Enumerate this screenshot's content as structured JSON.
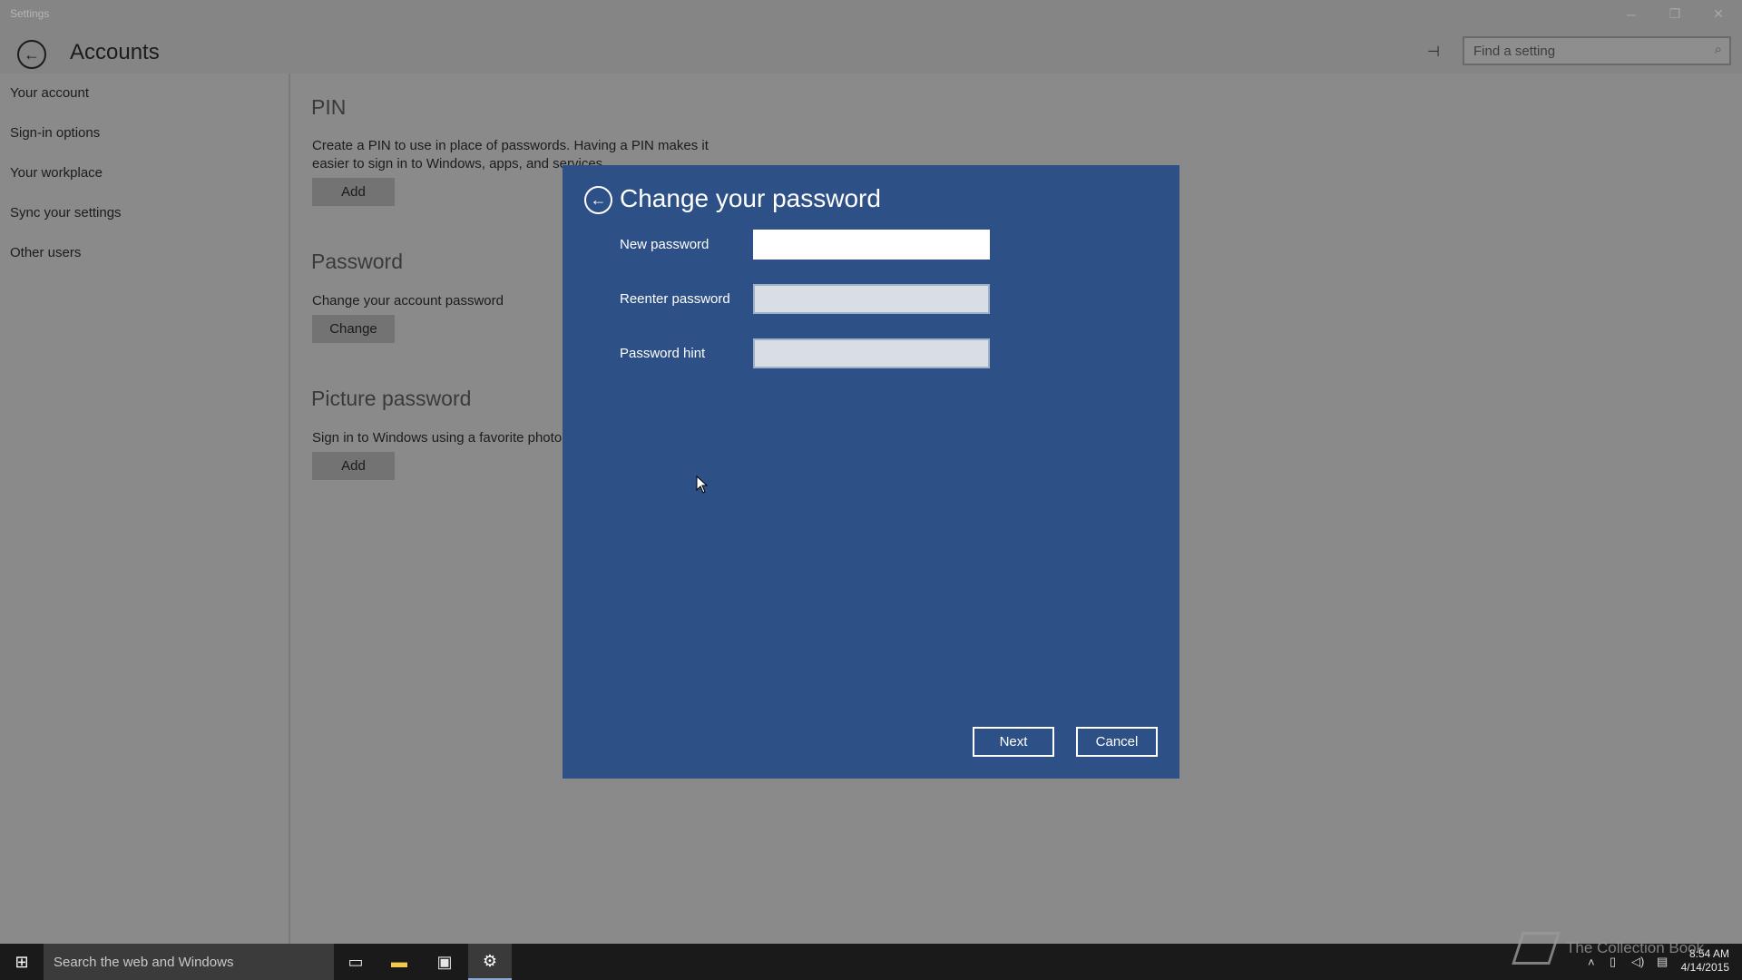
{
  "window": {
    "title": "Settings",
    "minimize": "─",
    "restore": "❐",
    "close": "✕"
  },
  "header": {
    "title": "Accounts",
    "back": "←",
    "pin": "⊣",
    "search_placeholder": "Find a setting",
    "search_icon": "⌕"
  },
  "sidebar": {
    "items": [
      {
        "label": "Your account"
      },
      {
        "label": "Sign-in options"
      },
      {
        "label": "Your workplace"
      },
      {
        "label": "Sync your settings"
      },
      {
        "label": "Other users"
      }
    ]
  },
  "main": {
    "pin": {
      "title": "PIN",
      "desc_line1": "Create a PIN to use in place of passwords. Having a PIN makes it",
      "desc_line2": "easier to sign in to Windows, apps, and services.",
      "button": "Add"
    },
    "password": {
      "title": "Password",
      "desc": "Change your account password",
      "button": "Change"
    },
    "picture_password": {
      "title": "Picture password",
      "desc": "Sign in to Windows using a favorite photo",
      "button": "Add"
    }
  },
  "dialog": {
    "title": "Change your password",
    "back": "←",
    "fields": [
      {
        "label": "New password",
        "value": ""
      },
      {
        "label": "Reenter password",
        "value": ""
      },
      {
        "label": "Password hint",
        "value": ""
      }
    ],
    "next": "Next",
    "cancel": "Cancel"
  },
  "taskbar": {
    "start": "⊞",
    "search_text": "Search the web and Windows",
    "task_view": "▭",
    "file_explorer": "▬",
    "store": "▣",
    "settings": "⚙",
    "tray_up": "˄",
    "network": "▯",
    "volume": "◁)",
    "message": "▤",
    "time": "8:54 AM",
    "date": "4/14/2015",
    "watermark": "The Collection Book"
  },
  "colors": {
    "dialog_bg": "#2d5086",
    "overlay_bg": "#8a8a8a",
    "taskbar_bg": "#1a1a1a"
  }
}
